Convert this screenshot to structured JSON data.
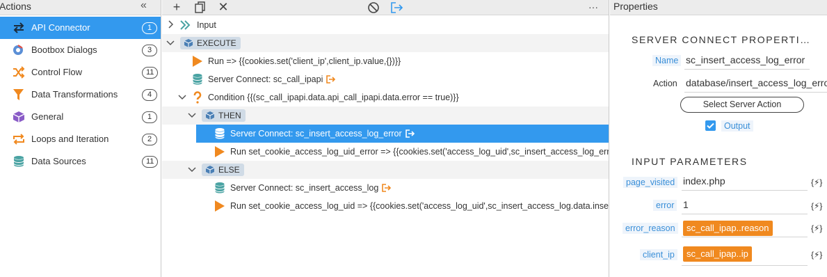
{
  "actions_panel": {
    "title": "Actions",
    "collapse_glyph": "«",
    "items": [
      {
        "label": "API Connector",
        "count": "1",
        "icon": "api-connector-icon",
        "active": true
      },
      {
        "label": "Bootbox Dialogs",
        "count": "3",
        "icon": "bootbox-icon"
      },
      {
        "label": "Control Flow",
        "count": "11",
        "icon": "control-flow-icon"
      },
      {
        "label": "Data Transformations",
        "count": "4",
        "icon": "filter-icon"
      },
      {
        "label": "General",
        "count": "1",
        "icon": "cube-icon"
      },
      {
        "label": "Loops and Iteration",
        "count": "2",
        "icon": "loop-icon"
      },
      {
        "label": "Data Sources",
        "count": "11",
        "icon": "database-icon"
      }
    ]
  },
  "toolbar": {
    "add": "+",
    "close": "✕",
    "more": "···"
  },
  "flow": {
    "input_label": "Input",
    "execute_label": "EXECUTE",
    "run1": "Run => {{cookies.set('client_ip',client_ip.value,{})}}",
    "sc1": "Server Connect: sc_call_ipapi",
    "condition": "Condition {{(sc_call_ipapi.data.api_call_ipapi.data.error == true)}}",
    "then_label": "THEN",
    "sc_then": "Server Connect: sc_insert_access_log_error",
    "run_then": "Run set_cookie_access_log_uid_error => {{cookies.set('access_log_uid',sc_insert_access_log_error.data.insert",
    "else_label": "ELSE",
    "sc_else": "Server Connect: sc_insert_access_log",
    "run_else": "Run set_cookie_access_log_uid => {{cookies.set('access_log_uid',sc_insert_access_log.data.insert_"
  },
  "properties": {
    "title": "Properties",
    "section_server": "SERVER CONNECT PROPERTI…",
    "name_label": "Name",
    "name_value": "sc_insert_access_log_error",
    "action_label": "Action",
    "action_value": "database/insert_access_log_error",
    "select_button": "Select Server Action",
    "output_label": "Output",
    "section_input": "INPUT PARAMETERS",
    "dyn_glyph": "{⚡}",
    "params": [
      {
        "label": "page_visited",
        "value": "index.php"
      },
      {
        "label": "error",
        "value": "1"
      },
      {
        "label": "error_reason",
        "value": "sc_call_ipap..reason"
      },
      {
        "label": "client_ip",
        "value": "sc_call_ipap..ip"
      }
    ]
  },
  "colors": {
    "accent": "#3399ee",
    "orange": "#f0891f",
    "teal": "#4aa3a3",
    "purple": "#8a5cc7"
  }
}
